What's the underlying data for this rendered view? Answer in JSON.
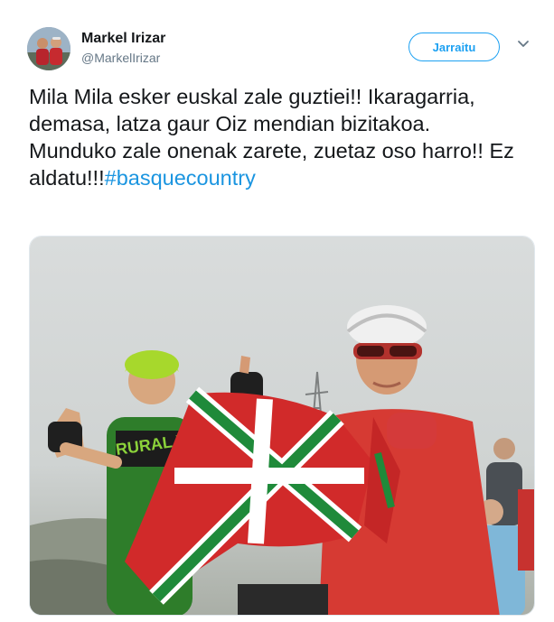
{
  "author": {
    "name": "Markel Irizar",
    "handle": "@MarkelIrizar"
  },
  "follow_button": {
    "label": "Jarraitu"
  },
  "tweet": {
    "text": "Mila Mila esker euskal zale guztiei!! Ikaragarria, demasa, latza gaur Oiz mendian bizitakoa. Munduko zale onenak zarete, zuetaz oso harro!! Ez aldatu!!!",
    "hashtag": "#basquecountry"
  },
  "icons": {
    "caret": "chevron-down-icon"
  },
  "colors": {
    "accent": "#1da1f2",
    "hashtag": "#1b95e0",
    "text": "#14171a",
    "secondary": "#657786"
  },
  "media": {
    "cyclist_left_jersey_text": "RURAL VIA"
  }
}
